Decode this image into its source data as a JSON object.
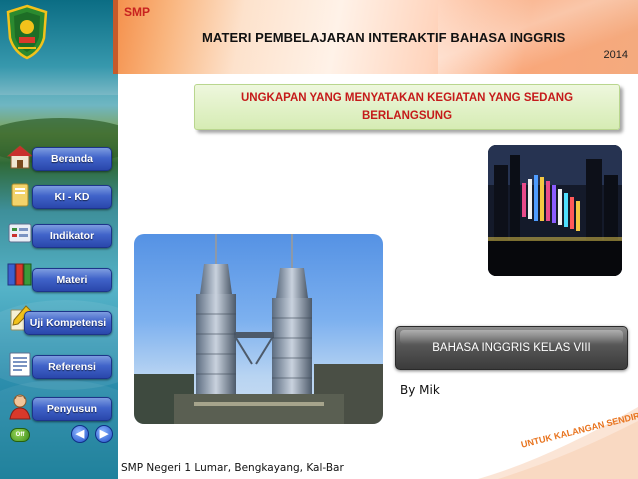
{
  "header": {
    "level_tag": "SMP",
    "title": "MATERI PEMBELAJARAN INTERAKTIF BAHASA INGGRIS",
    "year": "2014"
  },
  "topic": {
    "title": "UNGKAPAN YANG MENYATAKAN KEGIATAN  YANG SEDANG BERLANGSUNG"
  },
  "sidebar": {
    "items": [
      {
        "label": "Beranda",
        "icon": "home-icon"
      },
      {
        "label": "KI - KD",
        "icon": "folder-icon"
      },
      {
        "label": "Indikator",
        "icon": "checklist-icon"
      },
      {
        "label": "Materi",
        "icon": "binders-icon"
      },
      {
        "label": "Uji Kompetensi",
        "icon": "pencil-icon"
      },
      {
        "label": "Referensi",
        "icon": "document-icon"
      },
      {
        "label": "Penyusun",
        "icon": "person-icon"
      }
    ],
    "exit_label": "Off",
    "prev_icon": "arrow-left-icon",
    "next_icon": "arrow-right-icon"
  },
  "content": {
    "class_badge": "BAHASA INGGRIS KELAS VIII",
    "author": "By Mik"
  },
  "footer": {
    "school": "SMP Negeri 1 Lumar, Bengkayang, Kal-Bar",
    "corner_label": "UNTUK KALANGAN SENDIRI"
  },
  "colors": {
    "accent_red": "#c51a1a",
    "nav_blue": "#4063c9",
    "badge_gray": "#565656",
    "corner_orange": "#e8741f"
  }
}
